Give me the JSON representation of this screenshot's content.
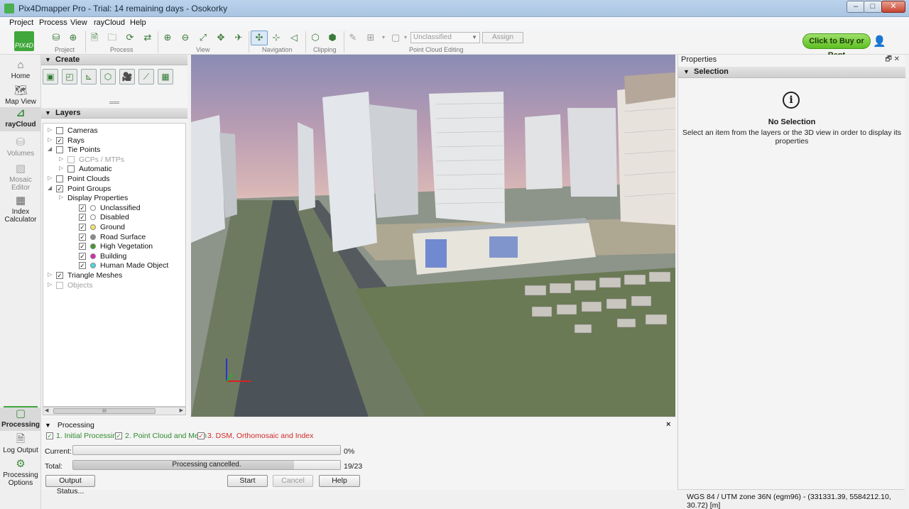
{
  "window": {
    "title": "Pix4Dmapper Pro - Trial: 14 remaining days - Osokorky",
    "minimize": "–",
    "maximize": "□",
    "close": "✕"
  },
  "menu": [
    "Project",
    "Process",
    "View",
    "rayCloud",
    "Help"
  ],
  "toolbar": {
    "logo_text": "PIX4D",
    "groups": {
      "project": "Project",
      "process": "Process",
      "view": "View",
      "navigation": "Navigation",
      "clipping": "Clipping",
      "point_cloud_editing": "Point Cloud Editing"
    },
    "class_select": {
      "value": "Unclassified"
    },
    "assign_label": "Assign",
    "buy_label": "Click to Buy or Rent"
  },
  "leftnav": {
    "items": [
      {
        "label": "Home",
        "icon": "home-icon"
      },
      {
        "label": "Map View",
        "icon": "map-icon"
      },
      {
        "label": "rayCloud",
        "icon": "raycloud-icon",
        "active": true
      },
      {
        "label": "Volumes",
        "icon": "volumes-icon"
      },
      {
        "label": "Mosaic Editor",
        "icon": "mosaic-icon"
      },
      {
        "label": "Index Calculator",
        "icon": "index-icon"
      }
    ],
    "bottom": [
      {
        "label": "Processing",
        "icon": "processing-icon",
        "active": true
      },
      {
        "label": "Log Output",
        "icon": "log-icon"
      },
      {
        "label": "Processing Options",
        "icon": "gear-icon"
      }
    ]
  },
  "create": {
    "header": "Create",
    "tools": [
      "▣",
      "◰",
      "⊾",
      "⬡",
      "🎥",
      "⟋",
      "▦"
    ]
  },
  "layers": {
    "header": "Layers",
    "tree": [
      {
        "label": "Cameras",
        "checked": false,
        "expander": "▷",
        "indent": 0
      },
      {
        "label": "Rays",
        "checked": true,
        "expander": "▷",
        "indent": 0
      },
      {
        "label": "Tie Points",
        "checked": false,
        "expander": "◢",
        "indent": 0
      },
      {
        "label": "GCPs / MTPs",
        "checked": false,
        "expander": "▷",
        "indent": 1,
        "disabled": true
      },
      {
        "label": "Automatic",
        "checked": false,
        "expander": "▷",
        "indent": 1
      },
      {
        "label": "Point Clouds",
        "checked": false,
        "expander": "▷",
        "indent": 0
      },
      {
        "label": "Point Groups",
        "checked": true,
        "expander": "◢",
        "indent": 0
      },
      {
        "label": "Display Properties",
        "expander": "▷",
        "indent": 1,
        "nocheck": true
      },
      {
        "label": "Unclassified",
        "checked": true,
        "indent": 2,
        "dot": "#ffffff"
      },
      {
        "label": "Disabled",
        "checked": true,
        "indent": 2,
        "dot": "#ffffff"
      },
      {
        "label": "Ground",
        "checked": true,
        "indent": 2,
        "dot": "#f3e26a"
      },
      {
        "label": "Road Surface",
        "checked": true,
        "indent": 2,
        "dot": "#8a8a8a"
      },
      {
        "label": "High Vegetation",
        "checked": true,
        "indent": 2,
        "dot": "#3f9a2c"
      },
      {
        "label": "Building",
        "checked": true,
        "indent": 2,
        "dot": "#d62ab8"
      },
      {
        "label": "Human Made Object",
        "checked": true,
        "indent": 2,
        "dot": "#4dd5e0"
      },
      {
        "label": "Triangle Meshes",
        "checked": true,
        "expander": "▷",
        "indent": 0
      },
      {
        "label": "Objects",
        "checked": false,
        "expander": "▷",
        "indent": 0,
        "disabled": true
      }
    ],
    "scroll_grip": "III"
  },
  "properties": {
    "title": "Properties",
    "window_controls": "🗗 ✕",
    "section": "Selection",
    "info_icon": "i",
    "no_selection_title": "No Selection",
    "no_selection_desc": "Select an item from the layers or the 3D view in order to display its properties"
  },
  "processing": {
    "header": "Processing",
    "close": "×",
    "steps": [
      {
        "label": "1. Initial Processing",
        "checked": true,
        "status": "done",
        "color": "#2e8b2e"
      },
      {
        "label": "2. Point Cloud and Mesh",
        "checked": true,
        "status": "done",
        "color": "#2e8b2e"
      },
      {
        "label": "3. DSM, Orthomosaic and Index",
        "checked": true,
        "status": "failed",
        "color": "#d22a2a"
      }
    ],
    "current": {
      "label": "Current:",
      "progress": 0,
      "value_text": "0%"
    },
    "total": {
      "label": "Total:",
      "progress": 0.826,
      "bar_text": "Processing cancelled.",
      "value_text": "19/23"
    },
    "buttons": {
      "output_status": "Output Status...",
      "start": "Start",
      "cancel": "Cancel",
      "help": "Help"
    }
  },
  "statusbar": {
    "text": "WGS 84 / UTM zone 36N (egm96) - (331331.39, 5584212.10, 30.72) [m]"
  }
}
